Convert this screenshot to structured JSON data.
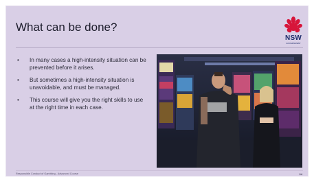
{
  "slide": {
    "title": "What can be done?",
    "logo": {
      "text": "NSW",
      "sub": "GOVERNMENT"
    },
    "bullets": [
      "In many cases a high-intensity situation can be prevented before it arises.",
      "But sometimes a high-intensity situation is unavoidable, and must be managed.",
      "This course will give you the right skills to use at the right time in each case."
    ],
    "footer": "Responsible Conduct of Gambling - Advanced Course",
    "page_number": "24"
  },
  "colors": {
    "background": "#d9cfe6",
    "title": "#1c1c2b",
    "logo_red": "#d7153a",
    "logo_blue": "#1f2d6b"
  }
}
